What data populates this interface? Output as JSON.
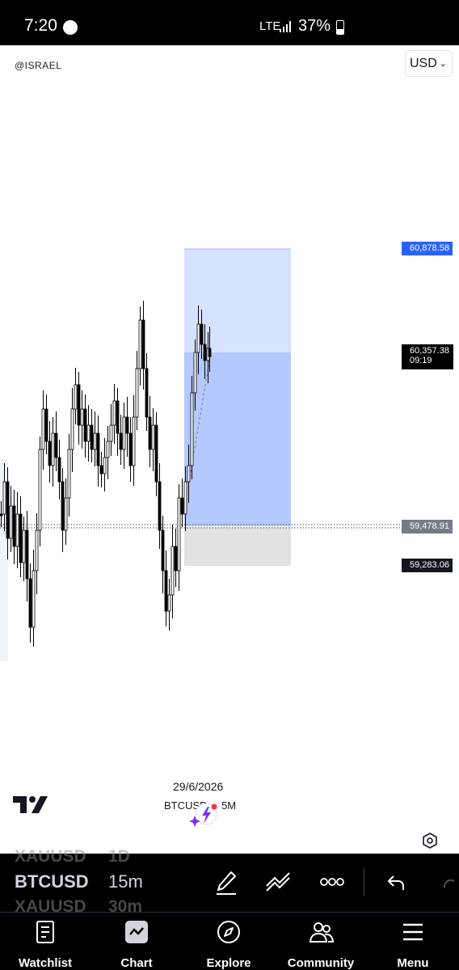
{
  "status_bar": {
    "time": "7:20",
    "network": "LTE",
    "battery": "37%"
  },
  "chart": {
    "watermark": "@ISRAEL",
    "currency": "USD",
    "price_tags": {
      "target": "60,878.58",
      "current": "60,357.38",
      "countdown": "09:19",
      "entry": "59,478.91",
      "stop": "59,283.06"
    },
    "date": "29/6/2026",
    "symbol": "BTCUSD",
    "symbol_interval": "5M",
    "colors": {
      "profit_zone": "#2962ff",
      "loss_zone": "#9598a1",
      "candles": "#000000"
    }
  },
  "toolbar": {
    "symbol_prev": "XAUUSD",
    "interval_prev": "1D",
    "symbol": "BTCUSD",
    "interval": "15m",
    "symbol_next": "XAUUSD",
    "interval_next": "30m"
  },
  "nav": {
    "watchlist": "Watchlist",
    "chart": "Chart",
    "explore": "Explore",
    "community": "Community",
    "menu": "Menu"
  }
}
